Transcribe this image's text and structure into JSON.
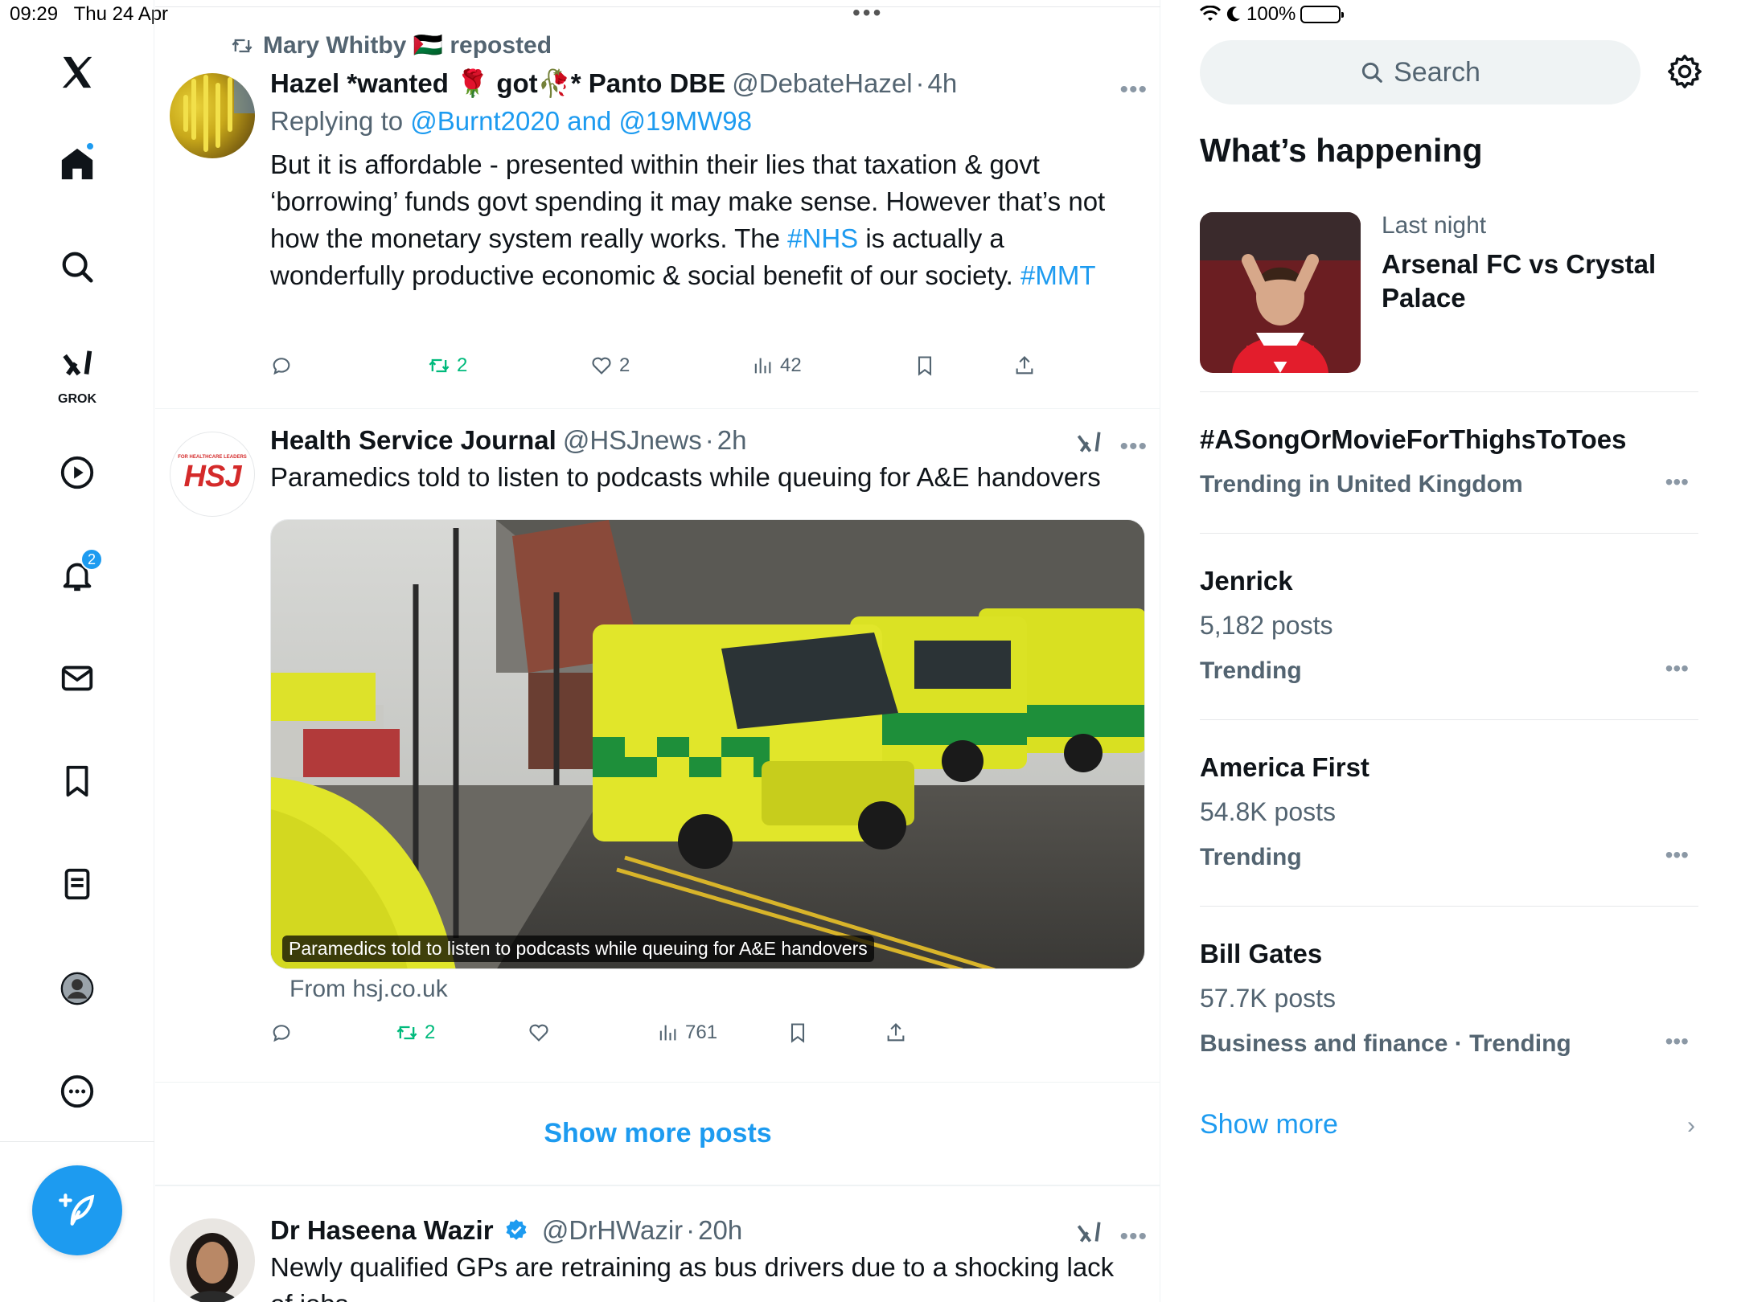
{
  "status": {
    "time": "09:29",
    "date": "Thu 24 Apr",
    "battery": "100%"
  },
  "nav": {
    "grok_label": "GROK",
    "notifications_count": "2",
    "icons": [
      "x-logo-icon",
      "home-icon",
      "search-icon",
      "grok-icon",
      "video-icon",
      "bell-icon",
      "mail-icon",
      "bookmark-icon",
      "list-icon",
      "profile-icon",
      "more-icon",
      "compose-icon"
    ]
  },
  "posts": [
    {
      "repost_by": "Mary Whitby 🇵🇸 reposted",
      "name": "Hazel *wanted 🌹 got🥀* Panto DBE",
      "handle": "@DebateHazel",
      "time": "4h",
      "reply_prefix": "Replying to ",
      "reply_to": "@Burnt2020 and @19MW98",
      "text_part1": "But it is affordable - presented within their lies that taxation & govt ‘borrowing’ funds govt spending it may make sense. However that’s not how the monetary system really works.  The ",
      "hashtag1": "#NHS",
      "text_part2": " is actually a wonderfully productive economic & social benefit of our society. ",
      "hashtag2": "#MMT",
      "reposts": "2",
      "likes": "2",
      "views": "42"
    },
    {
      "name": "Health Service Journal",
      "handle": "@HSJnews",
      "time": "2h",
      "avatar_text": "HSJ",
      "avatar_small": "FOR HEALTHCARE LEADERS",
      "text": "Paramedics told to listen to podcasts while queuing for A&E handovers",
      "card_caption": "Paramedics told to listen to podcasts while queuing for A&E handovers",
      "card_source": "From hsj.co.uk",
      "reposts": "2",
      "views": "761"
    },
    {
      "name": "Dr Haseena Wazir",
      "handle": "@DrHWazir",
      "time": "20h",
      "text": "Newly qualified GPs are retraining as bus drivers due to a shocking lack of jobs"
    }
  ],
  "show_more_posts": "Show more posts",
  "sidebar": {
    "search_placeholder": "Search",
    "whats_happening": "What’s happening",
    "featured": {
      "meta": "Last night",
      "title": "Arsenal FC vs Crystal Palace"
    },
    "trends": [
      {
        "name": "#ASongOrMovieForThighsToToes",
        "posts": "",
        "context": "Trending in United Kingdom"
      },
      {
        "name": "Jenrick",
        "posts": "5,182 posts",
        "context": "Trending"
      },
      {
        "name": "America First",
        "posts": "54.8K posts",
        "context": "Trending"
      },
      {
        "name": "Bill Gates",
        "posts": "57.7K posts",
        "context": "Business and finance · Trending"
      }
    ],
    "show_more": "Show more"
  },
  "colors": {
    "accent": "#1d9bf0",
    "repost_green": "#00ba7c",
    "muted": "#536471"
  }
}
